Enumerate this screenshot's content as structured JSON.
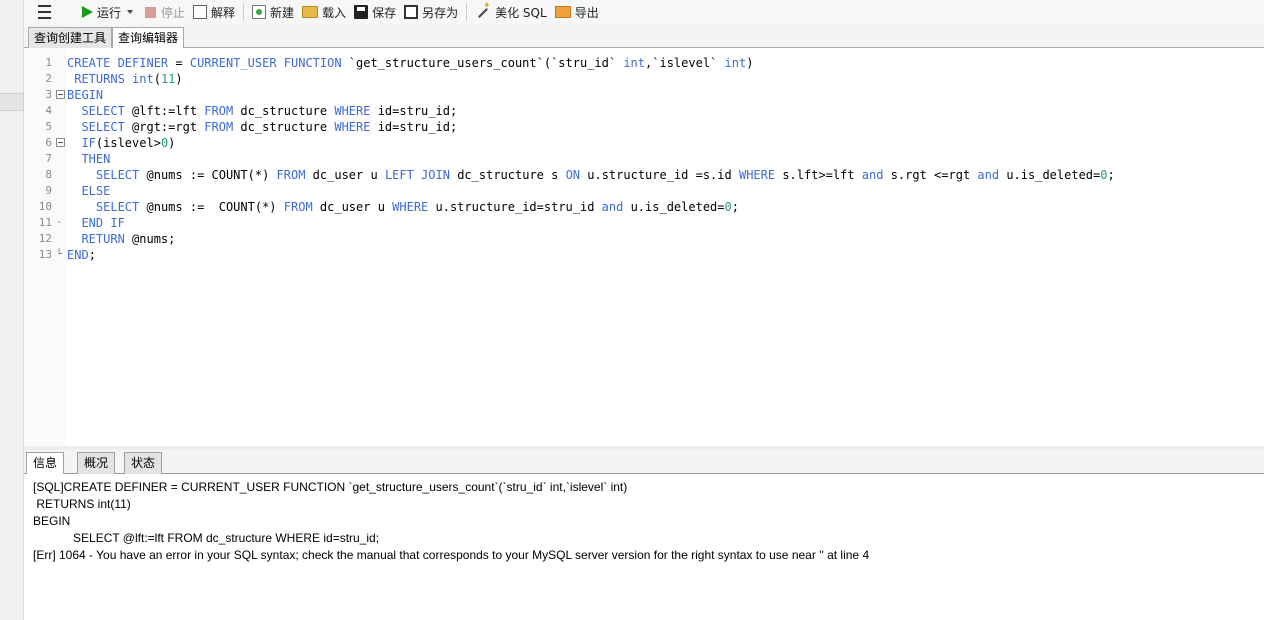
{
  "toolbar": {
    "run_label": "运行",
    "stop_label": "停止",
    "explain_label": "解释",
    "new_label": "新建",
    "load_label": "载入",
    "save_label": "保存",
    "saveas_label": "另存为",
    "beautify_label": "美化 SQL",
    "export_label": "导出"
  },
  "editor_tabs": [
    "查询创建工具",
    "查询编辑器"
  ],
  "active_editor_tab": "查询编辑器",
  "line_numbers": [
    "1",
    "2",
    "3",
    "4",
    "5",
    "6",
    "7",
    "8",
    "9",
    "10",
    "11",
    "12",
    "13"
  ],
  "code_lines": [
    [
      [
        "kw",
        "CREATE DEFINER"
      ],
      [
        "t",
        " = "
      ],
      [
        "kw",
        "CURRENT_USER FUNCTION"
      ],
      [
        "t",
        " `get_structure_users_count`(`stru_id` "
      ],
      [
        "kw",
        "int"
      ],
      [
        "t",
        ",`islevel` "
      ],
      [
        "kw",
        "int"
      ],
      [
        "t",
        ")"
      ]
    ],
    [
      [
        "t",
        " "
      ],
      [
        "kw",
        "RETURNS int"
      ],
      [
        "t",
        "("
      ],
      [
        "num",
        "11"
      ],
      [
        "t",
        ")"
      ]
    ],
    [
      [
        "kw",
        "BEGIN"
      ]
    ],
    [
      [
        "t",
        "  "
      ],
      [
        "kw",
        "SELECT"
      ],
      [
        "t",
        " @lft:=lft "
      ],
      [
        "kw",
        "FROM"
      ],
      [
        "t",
        " dc_structure "
      ],
      [
        "kw",
        "WHERE"
      ],
      [
        "t",
        " id=stru_id;"
      ]
    ],
    [
      [
        "t",
        "  "
      ],
      [
        "kw",
        "SELECT"
      ],
      [
        "t",
        " @rgt:=rgt "
      ],
      [
        "kw",
        "FROM"
      ],
      [
        "t",
        " dc_structure "
      ],
      [
        "kw",
        "WHERE"
      ],
      [
        "t",
        " id=stru_id;"
      ]
    ],
    [
      [
        "t",
        "  "
      ],
      [
        "kw",
        "IF"
      ],
      [
        "t",
        "(islevel>"
      ],
      [
        "num",
        "0"
      ],
      [
        "t",
        ")"
      ]
    ],
    [
      [
        "t",
        "  "
      ],
      [
        "kw",
        "THEN"
      ]
    ],
    [
      [
        "t",
        "    "
      ],
      [
        "kw",
        "SELECT"
      ],
      [
        "t",
        " @nums := COUNT(*) "
      ],
      [
        "kw",
        "FROM"
      ],
      [
        "t",
        " dc_user u "
      ],
      [
        "kw",
        "LEFT JOIN"
      ],
      [
        "t",
        " dc_structure s "
      ],
      [
        "kw",
        "ON"
      ],
      [
        "t",
        " u.structure_id =s.id "
      ],
      [
        "kw",
        "WHERE"
      ],
      [
        "t",
        " s.lft>=lft "
      ],
      [
        "kw",
        "and"
      ],
      [
        "t",
        " s.rgt <=rgt "
      ],
      [
        "kw",
        "and"
      ],
      [
        "t",
        " u.is_deleted="
      ],
      [
        "num",
        "0"
      ],
      [
        "t",
        ";"
      ]
    ],
    [
      [
        "t",
        "  "
      ],
      [
        "kw",
        "ELSE"
      ]
    ],
    [
      [
        "t",
        "    "
      ],
      [
        "kw",
        "SELECT"
      ],
      [
        "t",
        " @nums :=  COUNT(*) "
      ],
      [
        "kw",
        "FROM"
      ],
      [
        "t",
        " dc_user u "
      ],
      [
        "kw",
        "WHERE"
      ],
      [
        "t",
        " u.structure_id=stru_id "
      ],
      [
        "kw",
        "and"
      ],
      [
        "t",
        " u.is_deleted="
      ],
      [
        "num",
        "0"
      ],
      [
        "t",
        ";"
      ]
    ],
    [
      [
        "t",
        "  "
      ],
      [
        "kw",
        "END IF"
      ]
    ],
    [
      [
        "t",
        "  "
      ],
      [
        "kw",
        "RETURN"
      ],
      [
        "t",
        " @nums;"
      ]
    ],
    [
      [
        "kw",
        "END"
      ],
      [
        "t",
        ";"
      ]
    ]
  ],
  "result_tabs": [
    "信息",
    "概况",
    "状态"
  ],
  "active_result_tab": "信息",
  "messages": [
    "[SQL]CREATE DEFINER = CURRENT_USER FUNCTION `get_structure_users_count`(`stru_id` int,`islevel` int)",
    " RETURNS int(11)",
    "BEGIN",
    "            SELECT @lft:=lft FROM dc_structure WHERE id=stru_id;",
    "[Err] 1064 - You have an error in your SQL syntax; check the manual that corresponds to your MySQL server version for the right syntax to use near '' at line 4"
  ],
  "colors": {
    "keyword": "#3d6bd6",
    "number": "#27a070",
    "run_icon": "#1a9c1a"
  }
}
